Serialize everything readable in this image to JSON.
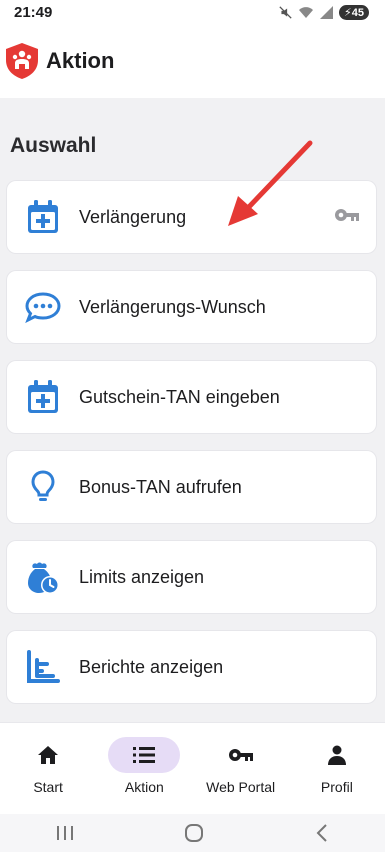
{
  "status_bar": {
    "time": "21:49",
    "battery": "45",
    "icons": [
      "mute-icon",
      "wifi-icon",
      "signal-icon",
      "battery-icon"
    ]
  },
  "app_bar": {
    "title": "Aktion",
    "logo": "shield-logo"
  },
  "section": {
    "title": "Auswahl"
  },
  "items": [
    {
      "label": "Verlängerung",
      "icon": "calendar-plus-icon",
      "trailing_icon": "key-icon"
    },
    {
      "label": "Verlängerungs-Wunsch",
      "icon": "chat-bubble-icon"
    },
    {
      "label": "Gutschein-TAN eingeben",
      "icon": "calendar-plus-icon"
    },
    {
      "label": "Bonus-TAN aufrufen",
      "icon": "lightbulb-icon"
    },
    {
      "label": "Limits anzeigen",
      "icon": "clock-bag-icon"
    },
    {
      "label": "Berichte anzeigen",
      "icon": "bar-chart-icon"
    }
  ],
  "bottom_nav": [
    {
      "label": "Start",
      "icon": "home-icon",
      "active": false
    },
    {
      "label": "Aktion",
      "icon": "list-icon",
      "active": true
    },
    {
      "label": "Web Portal",
      "icon": "key-icon",
      "active": false
    },
    {
      "label": "Profil",
      "icon": "person-icon",
      "active": false
    }
  ],
  "colors": {
    "accent_blue": "#2f7fd6",
    "annotation_arrow": "#e53935",
    "active_nav_pill": "#e6dcf6",
    "logo_red": "#e53935"
  }
}
